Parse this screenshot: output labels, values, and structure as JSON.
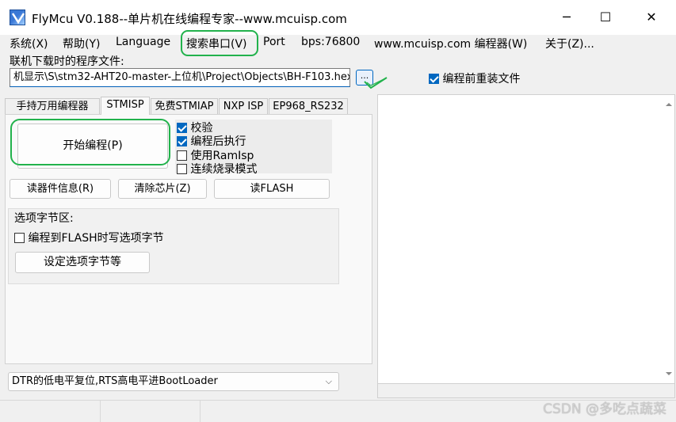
{
  "window": {
    "title": "FlyMcu V0.188--单片机在线编程专家--www.mcuisp.com",
    "minimize_glyph": "─",
    "maximize_glyph": "☐",
    "close_glyph": "✕"
  },
  "menu": {
    "items": [
      "系统(X)",
      "帮助(Y)",
      "Language",
      "搜索串口(V)",
      "Port",
      "bps:76800",
      "www.mcuisp.com 编程器(W)",
      "关于(Z)..."
    ]
  },
  "file": {
    "label": "联机下载时的程序文件:",
    "path": "机显示\\S\\stm32-AHT20-master-上位机\\Project\\Objects\\BH-F103.hex",
    "browse_label": "...",
    "reload_label": "编程前重装文件",
    "reload_checked": true
  },
  "tabs": [
    "手持万用编程器",
    "STMISP",
    "免费STMIAP",
    "NXP ISP",
    "EP968_RS232"
  ],
  "active_tab": "STMISP",
  "program_panel": {
    "start_button": "开始编程(P)",
    "options": [
      {
        "label": "校验",
        "checked": true
      },
      {
        "label": "编程后执行",
        "checked": true
      },
      {
        "label": "使用RamIsp",
        "checked": false
      },
      {
        "label": "连续烧录模式",
        "checked": false
      }
    ],
    "read_info_button": "读器件信息(R)",
    "erase_button": "清除芯片(Z)",
    "read_flash_button": "读FLASH",
    "option_bytes": {
      "title": "选项字节区:",
      "write_label": "编程到FLASH时写选项字节",
      "write_checked": false,
      "set_button": "设定选项字节等"
    },
    "reset_mode": "DTR的低电平复位,RTS高电平进BootLoader",
    "combo_arrow": "⌵"
  },
  "watermark": "CSDN @多吃点蔬菜",
  "colors": {
    "highlight_ring": "#22b24c",
    "accent": "#0067c0"
  }
}
